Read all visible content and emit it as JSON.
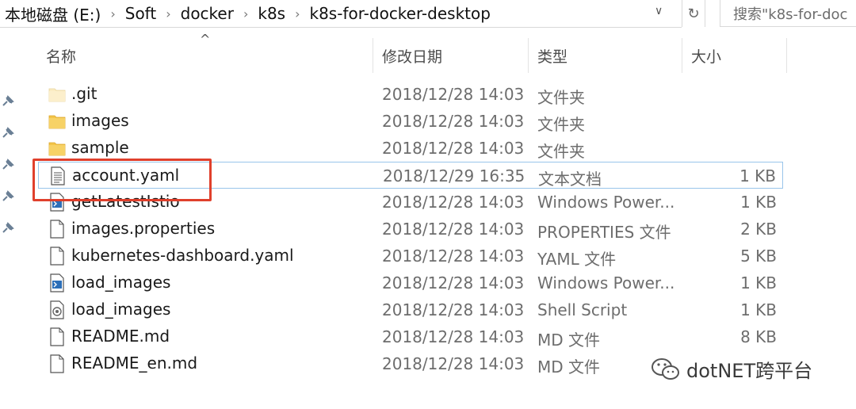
{
  "address_bar": {
    "crumbs": [
      "本地磁盘 (E:)",
      "Soft",
      "docker",
      "k8s",
      "k8s-for-docker-desktop"
    ],
    "separator": "›",
    "dropdown_glyph": "∨",
    "refresh_glyph": "↻"
  },
  "search": {
    "placeholder": "搜索\"k8s-for-doc"
  },
  "columns": {
    "sort_glyph": "^",
    "name": "名称",
    "date": "修改日期",
    "type": "类型",
    "size": "大小"
  },
  "files": [
    {
      "name": ".git",
      "date": "2018/12/28 14:03",
      "type": "文件夹",
      "size": "",
      "icon": "folder-light-icon"
    },
    {
      "name": "images",
      "date": "2018/12/28 14:03",
      "type": "文件夹",
      "size": "",
      "icon": "folder-icon"
    },
    {
      "name": "sample",
      "date": "2018/12/28 14:03",
      "type": "文件夹",
      "size": "",
      "icon": "folder-icon"
    },
    {
      "name": "account.yaml",
      "date": "2018/12/29 16:35",
      "type": "文本文档",
      "size": "1 KB",
      "icon": "text-file-icon"
    },
    {
      "name": "getLatestIstio",
      "date": "2018/12/28 14:03",
      "type": "Windows Power...",
      "size": "1 KB",
      "icon": "powershell-file-icon"
    },
    {
      "name": "images.properties",
      "date": "2018/12/28 14:03",
      "type": "PROPERTIES 文件",
      "size": "2 KB",
      "icon": "blank-file-icon"
    },
    {
      "name": "kubernetes-dashboard.yaml",
      "date": "2018/12/28 14:03",
      "type": "YAML 文件",
      "size": "5 KB",
      "icon": "blank-file-icon"
    },
    {
      "name": "load_images",
      "date": "2018/12/28 14:03",
      "type": "Windows Power...",
      "size": "1 KB",
      "icon": "powershell-file-icon"
    },
    {
      "name": "load_images",
      "date": "2018/12/28 14:03",
      "type": "Shell Script",
      "size": "1 KB",
      "icon": "shell-script-icon"
    },
    {
      "name": "README.md",
      "date": "2018/12/28 14:03",
      "type": "MD 文件",
      "size": "8 KB",
      "icon": "blank-file-icon"
    },
    {
      "name": "README_en.md",
      "date": "2018/12/28 14:03",
      "type": "MD 文件",
      "size": "",
      "icon": "blank-file-icon"
    }
  ],
  "selected_index": 3,
  "watermark": {
    "text": "dotNET跨平台",
    "icon": "wechat-icon"
  },
  "colors": {
    "highlight": "#e0402c",
    "folder": "#f3c54a",
    "selection_border": "#99c5ea"
  }
}
